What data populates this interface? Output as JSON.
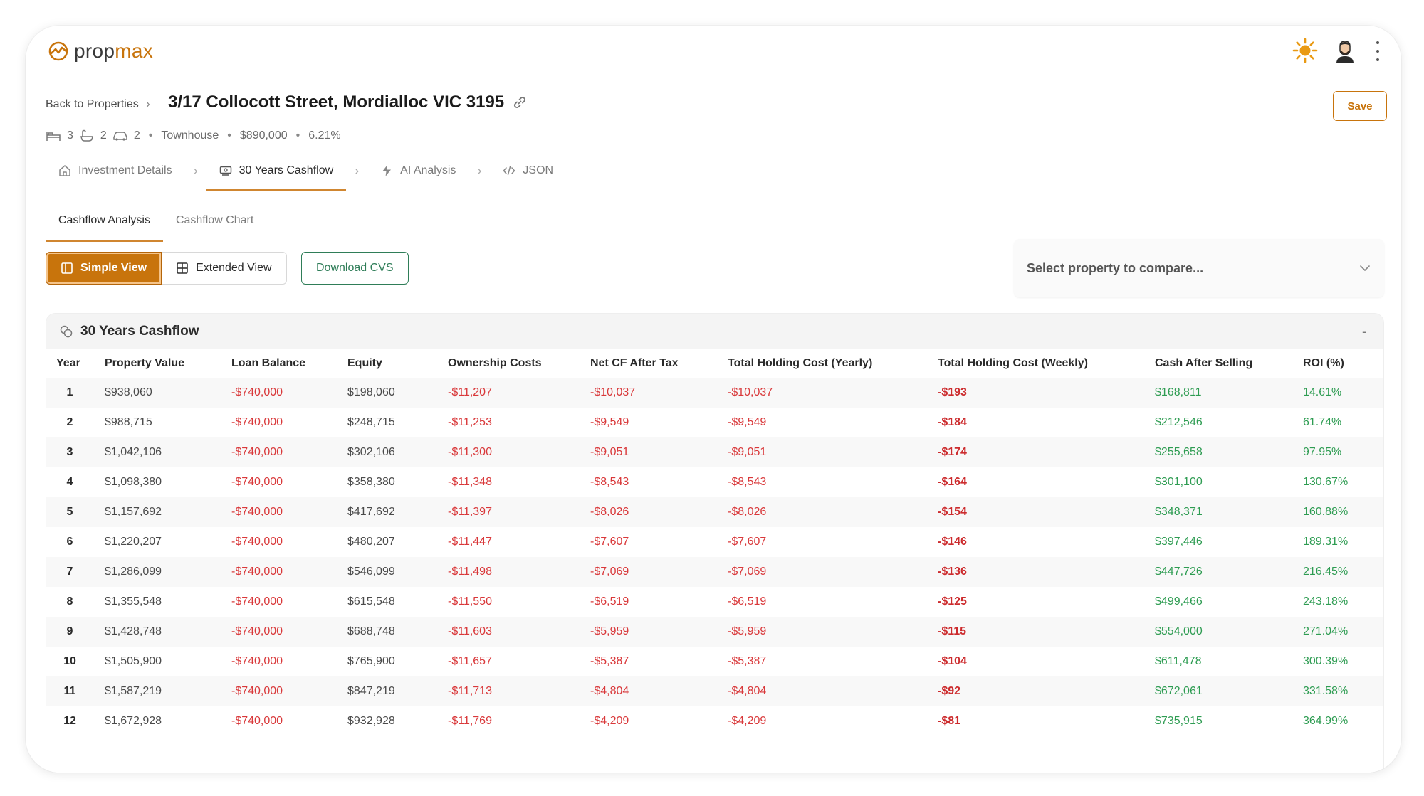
{
  "app": {
    "logo_prefix": "prop",
    "logo_suffix": "max",
    "colors": {
      "accent": "#c8740c",
      "negative": "#d9383a",
      "positive": "#2e9c52",
      "download": "#2f7d58"
    }
  },
  "header": {
    "back_label": "Back to Properties",
    "title": "3/17 Collocott Street, Mordialloc VIC 3195",
    "save_label": "Save",
    "meta": {
      "beds": "3",
      "baths": "2",
      "cars": "2",
      "type": "Townhouse",
      "price": "$890,000",
      "rate": "6.21%"
    }
  },
  "main_tabs": [
    {
      "label": "Investment Details",
      "icon": "home-icon"
    },
    {
      "label": "30 Years Cashflow",
      "icon": "cashflow-icon",
      "active": true
    },
    {
      "label": "AI Analysis",
      "icon": "lightning-icon"
    },
    {
      "label": "JSON",
      "icon": "code-icon"
    }
  ],
  "sub_tabs": [
    {
      "label": "Cashflow Analysis",
      "active": true
    },
    {
      "label": "Cashflow Chart"
    }
  ],
  "controls": {
    "simple_view": "Simple View",
    "extended_view": "Extended View",
    "download": "Download CVS",
    "compare_placeholder": "Select property to compare..."
  },
  "table": {
    "title": "30 Years Cashflow",
    "collapse": "-",
    "columns": [
      "Year",
      "Property Value",
      "Loan Balance",
      "Equity",
      "Ownership Costs",
      "Net CF After Tax",
      "Total Holding Cost (Yearly)",
      "Total Holding Cost (Weekly)",
      "Cash After Selling",
      "ROI (%)"
    ],
    "rows": [
      [
        "1",
        "$938,060",
        "-$740,000",
        "$198,060",
        "-$11,207",
        "-$10,037",
        "-$10,037",
        "-$193",
        "$168,811",
        "14.61%"
      ],
      [
        "2",
        "$988,715",
        "-$740,000",
        "$248,715",
        "-$11,253",
        "-$9,549",
        "-$9,549",
        "-$184",
        "$212,546",
        "61.74%"
      ],
      [
        "3",
        "$1,042,106",
        "-$740,000",
        "$302,106",
        "-$11,300",
        "-$9,051",
        "-$9,051",
        "-$174",
        "$255,658",
        "97.95%"
      ],
      [
        "4",
        "$1,098,380",
        "-$740,000",
        "$358,380",
        "-$11,348",
        "-$8,543",
        "-$8,543",
        "-$164",
        "$301,100",
        "130.67%"
      ],
      [
        "5",
        "$1,157,692",
        "-$740,000",
        "$417,692",
        "-$11,397",
        "-$8,026",
        "-$8,026",
        "-$154",
        "$348,371",
        "160.88%"
      ],
      [
        "6",
        "$1,220,207",
        "-$740,000",
        "$480,207",
        "-$11,447",
        "-$7,607",
        "-$7,607",
        "-$146",
        "$397,446",
        "189.31%"
      ],
      [
        "7",
        "$1,286,099",
        "-$740,000",
        "$546,099",
        "-$11,498",
        "-$7,069",
        "-$7,069",
        "-$136",
        "$447,726",
        "216.45%"
      ],
      [
        "8",
        "$1,355,548",
        "-$740,000",
        "$615,548",
        "-$11,550",
        "-$6,519",
        "-$6,519",
        "-$125",
        "$499,466",
        "243.18%"
      ],
      [
        "9",
        "$1,428,748",
        "-$740,000",
        "$688,748",
        "-$11,603",
        "-$5,959",
        "-$5,959",
        "-$115",
        "$554,000",
        "271.04%"
      ],
      [
        "10",
        "$1,505,900",
        "-$740,000",
        "$765,900",
        "-$11,657",
        "-$5,387",
        "-$5,387",
        "-$104",
        "$611,478",
        "300.39%"
      ],
      [
        "11",
        "$1,587,219",
        "-$740,000",
        "$847,219",
        "-$11,713",
        "-$4,804",
        "-$4,804",
        "-$92",
        "$672,061",
        "331.58%"
      ],
      [
        "12",
        "$1,672,928",
        "-$740,000",
        "$932,928",
        "-$11,769",
        "-$4,209",
        "-$4,209",
        "-$81",
        "$735,915",
        "364.99%"
      ]
    ]
  }
}
